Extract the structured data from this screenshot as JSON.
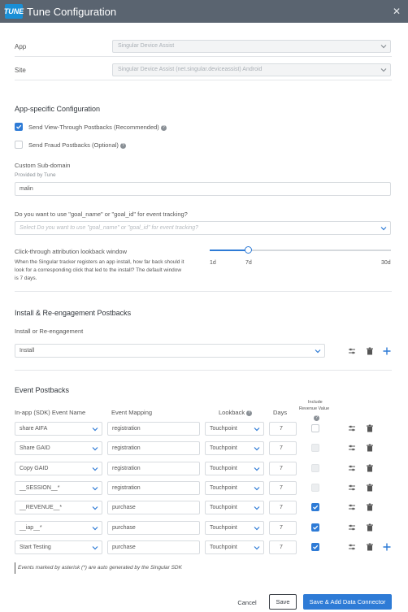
{
  "window": {
    "logo": "TUNE",
    "title": "Tune Configuration"
  },
  "fields": {
    "app_label": "App",
    "app_value": "Singular Device Assist",
    "site_label": "Site",
    "site_value": "Singular Device Assist (net.singular.deviceassist) Android"
  },
  "app_config": {
    "title": "App-specific Configuration",
    "view_through_label": "Send View-Through Postbacks",
    "view_through_tag": "(Recommended)",
    "view_through_checked": true,
    "fraud_label": "Send Fraud Postbacks",
    "fraud_tag": "(Optional)",
    "fraud_checked": false,
    "subdomain_label": "Custom Sub-domain",
    "subdomain_hint": "Provided by Tune",
    "subdomain_value": "malin",
    "goal_question": "Do you want to use \"goal_name\" or \"goal_id\" for event tracking?",
    "goal_placeholder": "Select Do you want to use \"goal_name\" or \"goal_id\" for event tracking?",
    "lookback_title": "Click-through attribution lookback window",
    "lookback_desc_1": "When the Singular tracker registers an app install, how far back should it",
    "lookback_desc_2": "look for a corresponding click that led to the install? The default window",
    "lookback_desc_3": "is 7 days.",
    "slider_min": "1d",
    "slider_mid": "7d",
    "slider_max": "30d",
    "slider_value_days": 7
  },
  "install": {
    "title": "Install & Re-engagement Postbacks",
    "field_label": "Install or Re-engagement",
    "value": "Install"
  },
  "events": {
    "title": "Event Postbacks",
    "col_sdk": "In-app (SDK) Event Name",
    "col_mapping": "Event Mapping",
    "col_lookback": "Lookback",
    "col_days": "Days",
    "col_revenue_1": "Include",
    "col_revenue_2": "Revenue Value",
    "rows": [
      {
        "sdk": "share AIFA",
        "mapping": "registration",
        "lookback": "Touchpoint",
        "days": "7",
        "revenue": "off"
      },
      {
        "sdk": "Share GAID",
        "mapping": "registration",
        "lookback": "Touchpoint",
        "days": "7",
        "revenue": "disabled"
      },
      {
        "sdk": "Copy GAID",
        "mapping": "registration",
        "lookback": "Touchpoint",
        "days": "7",
        "revenue": "disabled"
      },
      {
        "sdk": "__SESSION__*",
        "mapping": "registration",
        "lookback": "Touchpoint",
        "days": "7",
        "revenue": "disabled"
      },
      {
        "sdk": "__REVENUE__*",
        "mapping": "purchase",
        "lookback": "Touchpoint",
        "days": "7",
        "revenue": "on"
      },
      {
        "sdk": "__iap__*",
        "mapping": "purchase",
        "lookback": "Touchpoint",
        "days": "7",
        "revenue": "on"
      },
      {
        "sdk": "Start Testing",
        "mapping": "purchase",
        "lookback": "Touchpoint",
        "days": "7",
        "revenue": "on"
      }
    ],
    "note": "Events marked by asterisk (*) are auto generated by the Singular SDK"
  },
  "footer": {
    "cancel": "Cancel",
    "save": "Save",
    "save_add": "Save & Add Data Connector"
  },
  "colors": {
    "titlebar": "#5a6470",
    "accent": "#2e7bd6",
    "logo": "#1a8fd6"
  }
}
